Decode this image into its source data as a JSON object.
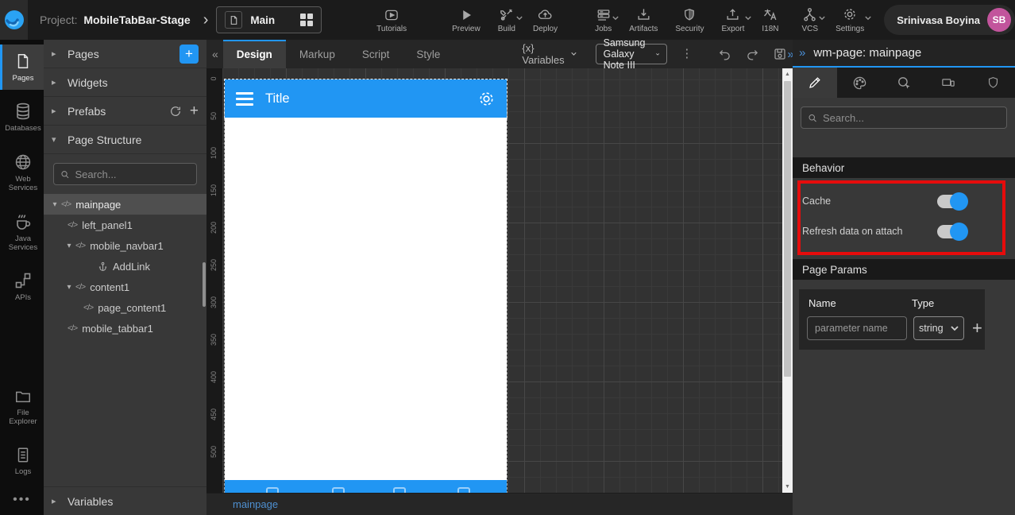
{
  "topbar": {
    "project_label": "Project:",
    "project_name": "MobileTabBar-Stage",
    "page_selector": {
      "name": "Main"
    },
    "actions": [
      {
        "label": "Tutorials"
      },
      {
        "label": "Preview"
      },
      {
        "label": "Build"
      },
      {
        "label": "Deploy"
      },
      {
        "label": "Jobs"
      },
      {
        "label": "Artifacts"
      },
      {
        "label": "Security"
      },
      {
        "label": "Export"
      },
      {
        "label": "I18N"
      },
      {
        "label": "VCS"
      },
      {
        "label": "Settings"
      }
    ],
    "user": {
      "name": "Srinivasa Boyina",
      "initials": "SB"
    }
  },
  "iconbar": {
    "items": [
      {
        "label": "Pages"
      },
      {
        "label": "Databases"
      },
      {
        "label": "Web Services"
      },
      {
        "label": "Java Services"
      },
      {
        "label": "APIs"
      },
      {
        "label": "File Explorer"
      },
      {
        "label": "Logs"
      }
    ]
  },
  "left_panel": {
    "sections": {
      "pages": "Pages",
      "widgets": "Widgets",
      "prefabs": "Prefabs",
      "page_structure": "Page Structure",
      "variables": "Variables"
    },
    "search_placeholder": "Search...",
    "tree": [
      {
        "label": "mainpage"
      },
      {
        "label": "left_panel1"
      },
      {
        "label": "mobile_navbar1"
      },
      {
        "label": "AddLink"
      },
      {
        "label": "content1"
      },
      {
        "label": "page_content1"
      },
      {
        "label": "mobile_tabbar1"
      }
    ]
  },
  "editor": {
    "tabs": [
      "Design",
      "Markup",
      "Script",
      "Style"
    ],
    "variables_label": "{x} Variables",
    "device": "Samsung Galaxy Note III",
    "page_tab": "mainpage",
    "ruler_labels": [
      "0",
      "50",
      "100",
      "150",
      "200",
      "250",
      "300",
      "350",
      "400",
      "450",
      "500"
    ],
    "phone": {
      "title": "Title"
    }
  },
  "right_panel": {
    "title": "wm-page: mainpage",
    "search_placeholder": "Search...",
    "behavior": {
      "header": "Behavior",
      "toggles": [
        {
          "label": "Cache",
          "state": "on"
        },
        {
          "label": "Refresh data on attach",
          "state": "on"
        }
      ]
    },
    "page_params": {
      "header": "Page Params",
      "name_col": "Name",
      "type_col": "Type",
      "name_placeholder": "parameter name",
      "type_value": "string"
    }
  },
  "glyphs": {
    "collapse_left": "«",
    "expand_right": "»",
    "kebab": "⋮",
    "plus": "+",
    "code": "</>",
    "tree_collapsed": "▸",
    "tree_expanded": "▾",
    "ellipsis": "•••",
    "chevron": "›",
    "up_arrow": "▲",
    "down_arrow": "▼"
  },
  "colors": {
    "accent": "#2196f3",
    "annotation_box": "#e60c0c",
    "avatar": "#c2549c"
  }
}
